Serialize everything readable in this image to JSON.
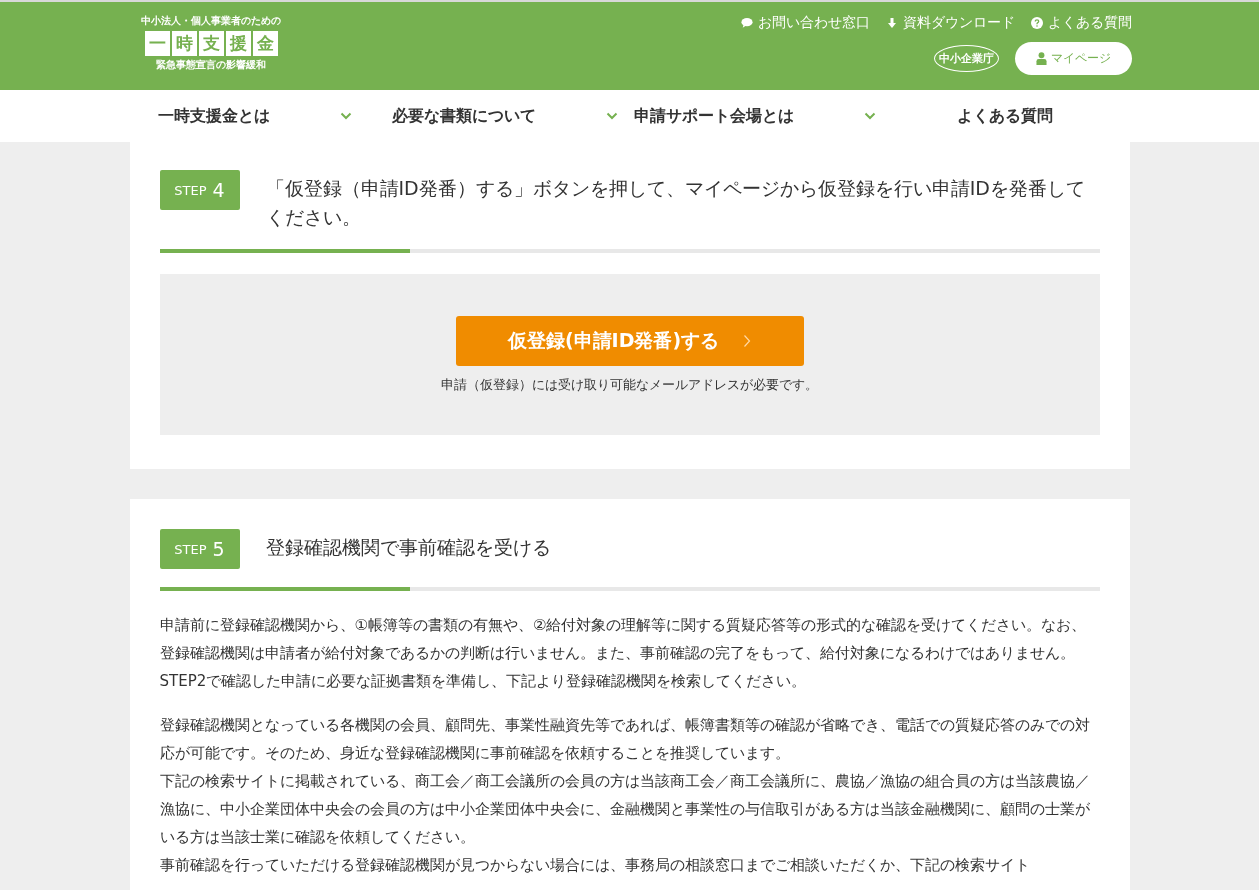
{
  "header": {
    "logo": {
      "tagline": "中小法人・個人事業者のための",
      "characters": [
        "一",
        "時",
        "支",
        "援",
        "金"
      ],
      "subtitle": "緊急事態宣言の影響緩和"
    },
    "links": [
      {
        "kind": "chat",
        "label": "お問い合わせ窓口"
      },
      {
        "kind": "download",
        "label": "資料ダウンロード"
      },
      {
        "kind": "help",
        "label": "よくある質問"
      }
    ],
    "agency_logo": "中小企業庁",
    "mypage_button": "マイページ"
  },
  "nav": [
    {
      "label": "一時支援金とは",
      "expandable": true
    },
    {
      "label": "必要な書類について",
      "expandable": true
    },
    {
      "label": "申請サポート会場とは",
      "expandable": true
    },
    {
      "label": "よくある質問",
      "expandable": false
    }
  ],
  "steps": [
    {
      "badge": "STEP",
      "number": "4",
      "title": "「仮登録（申請ID発番）する」ボタンを押して、マイページから仮登録を行い申請IDを発番してください。",
      "button": "仮登録(申請ID発番)する",
      "note": "申請（仮登録）には受け取り可能なメールアドレスが必要です。"
    },
    {
      "badge": "STEP",
      "number": "5",
      "title": "登録確認機関で事前確認を受ける",
      "paragraphs": [
        [
          "申請前に登録確認機関から、①帳簿等の書類の有無や、②給付対象の理解等に関する質疑応答等の形式的な確認を受けてください。なお、登録確認機関は申請者が給付対象であるかの判断は行いません。また、事前確認の完了をもって、給付対象になるわけではありません。STEP2で確認した申請に必要な証拠書類を準備し、下記より登録確認機関を検索してください。"
        ],
        [
          "登録確認機関となっている各機関の会員、顧問先、事業性融資先等であれば、帳簿書類等の確認が省略でき、電話での質疑応答のみでの対応が可能です。そのため、身近な登録確認機関に事前確認を依頼することを推奨しています。",
          "下記の検索サイトに掲載されている、商工会／商工会議所の会員の方は当該商工会／商工会議所に、農協／漁協の組合員の方は当該農協／漁協に、中小企業団体中央会の会員の方は中小企業団体中央会に、金融機関と事業性の与信取引がある方は当該金融機関に、顧問の士業がいる方は当該士業に確認を依頼してください。",
          "事前確認を行っていただける登録確認機関が見つからない場合には、事務局の相談窓口までご相談いただくか、下記の検索サイト"
        ]
      ]
    }
  ]
}
